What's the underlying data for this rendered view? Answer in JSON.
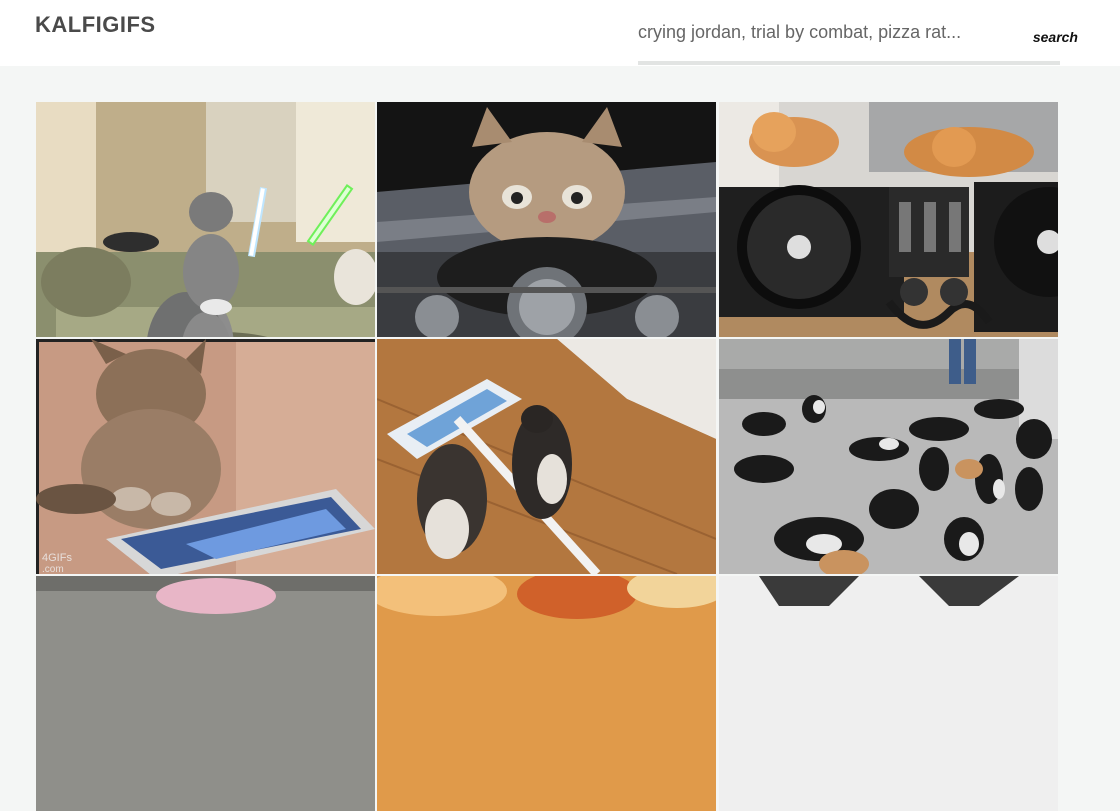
{
  "header": {
    "logo": "KALFIGIFS",
    "search": {
      "placeholder": "crying jordan, trial by combat, pizza rat...",
      "value": "",
      "button_label": "search"
    }
  },
  "gallery": {
    "watermark": "4GIFs\n.com",
    "tiles": [
      {
        "name": "gif-tile-lightsaber-cats"
      },
      {
        "name": "gif-tile-motorcycle-cat"
      },
      {
        "name": "gif-tile-dj-cats"
      },
      {
        "name": "gif-tile-tablet-kitten"
      },
      {
        "name": "gif-tile-mop-kittens"
      },
      {
        "name": "gif-tile-cat-herd"
      },
      {
        "name": "gif-tile-row3-left"
      },
      {
        "name": "gif-tile-row3-middle"
      },
      {
        "name": "gif-tile-row3-right"
      }
    ]
  },
  "colors": {
    "page_bg": "#f4f6f5",
    "header_bg": "#ffffff",
    "logo": "#4a4a4a",
    "underline": "#e2e4e3"
  }
}
